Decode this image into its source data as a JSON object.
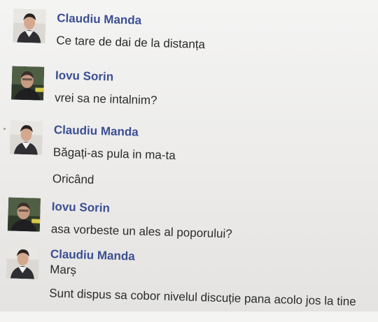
{
  "messages": [
    {
      "author": "Claudiu Manda",
      "avatar_icon": "user-avatar-claudiu",
      "lines": [
        "Ce tare de dai de la distanța"
      ]
    },
    {
      "author": "Iovu Sorin",
      "avatar_icon": "user-avatar-sorin",
      "lines": [
        "vrei sa ne intalnim?"
      ]
    },
    {
      "author": "Claudiu Manda",
      "avatar_icon": "user-avatar-claudiu",
      "lines": [
        "Băgați-as pula in ma-ta",
        "Oricând"
      ]
    },
    {
      "author": "Iovu Sorin",
      "avatar_icon": "user-avatar-sorin",
      "lines": [
        "asa vorbeste un ales al poporului?"
      ]
    },
    {
      "author": "Claudiu Manda",
      "avatar_icon": "user-avatar-claudiu",
      "lines": [
        "Marș",
        "Sunt dispus sa cobor nivelul discuție pana acolo jos la tine"
      ]
    }
  ],
  "colors": {
    "author_name": "#3b4f93",
    "message_text": "#2b2b2b",
    "background": "#efeeed"
  }
}
